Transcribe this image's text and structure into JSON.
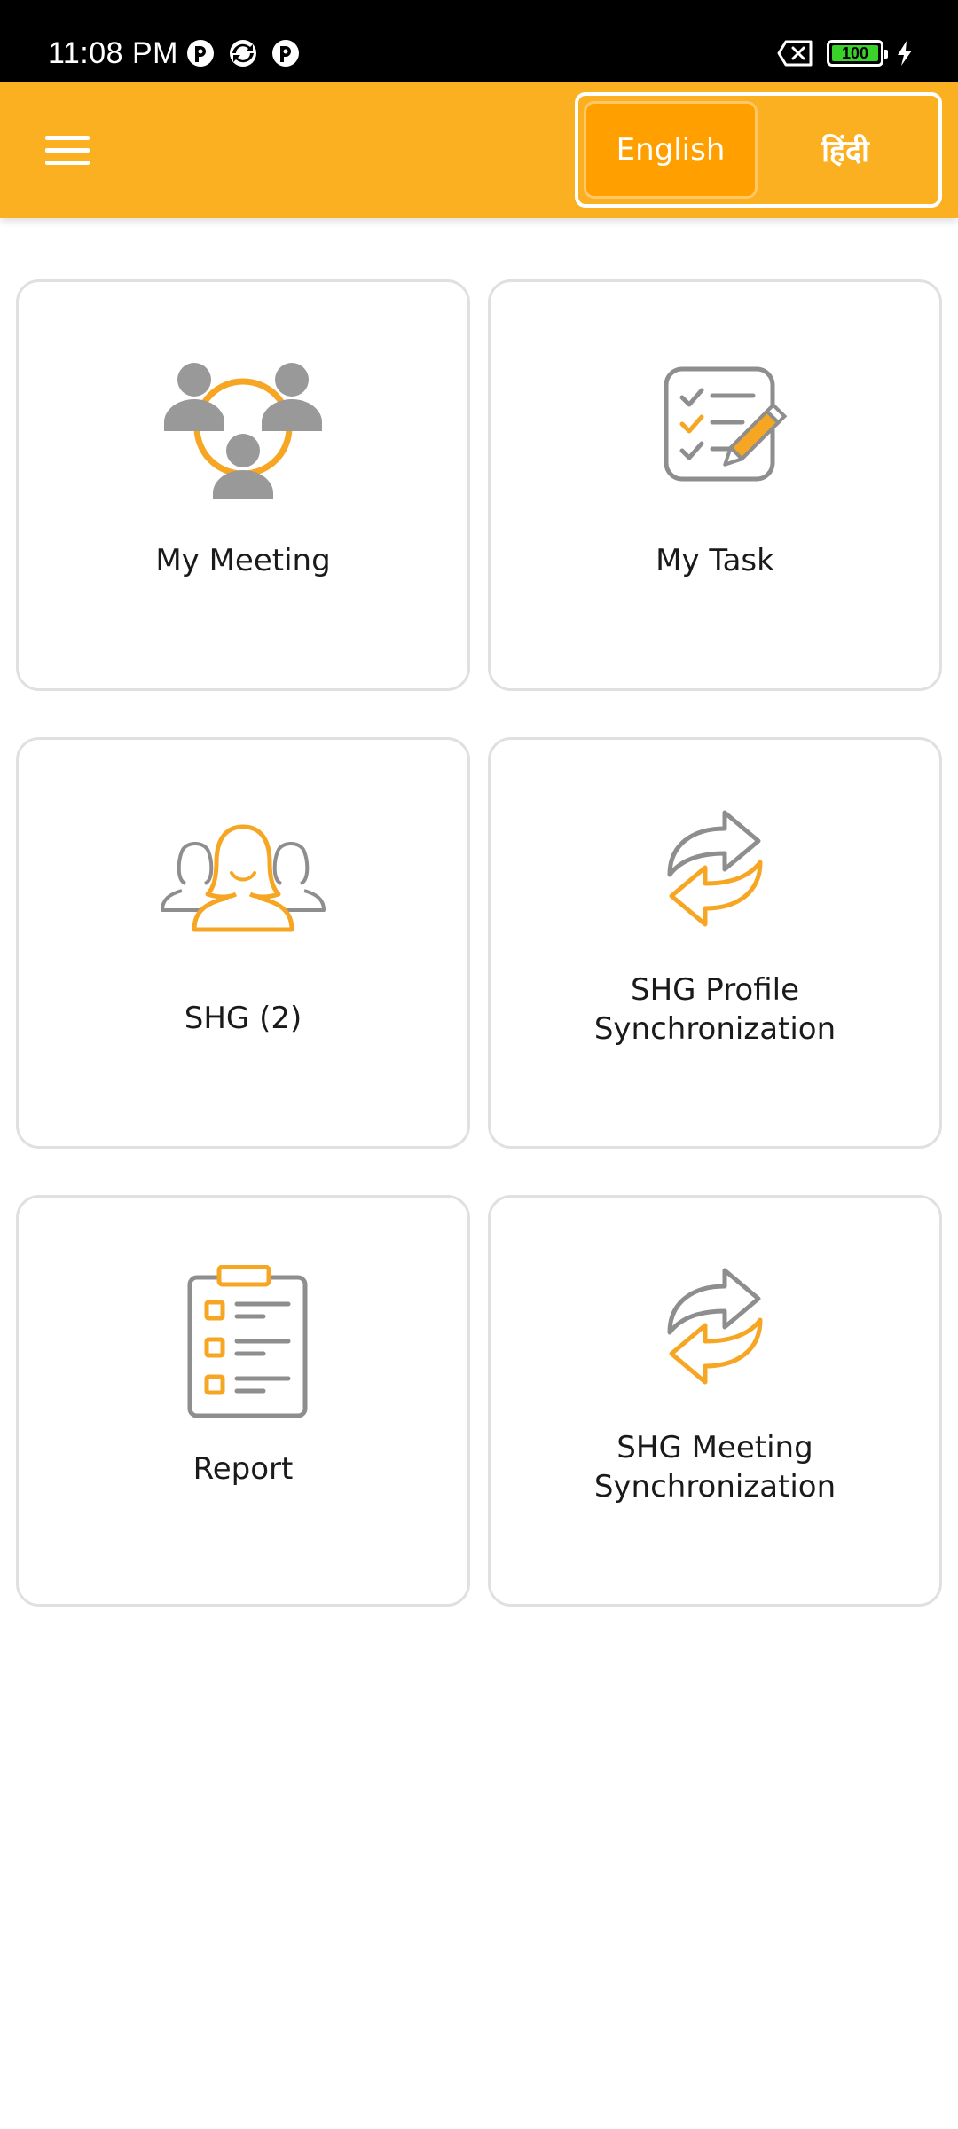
{
  "status_bar": {
    "time": "11:08 PM",
    "battery_level": "100",
    "battery_color": "#39d12a"
  },
  "app_bar": {
    "background": "#fbb021",
    "menu_icon": "hamburger-menu-icon",
    "language": {
      "english": "English",
      "hindi": "हिंदी",
      "selected": "English"
    }
  },
  "tiles": [
    {
      "label": "My Meeting",
      "icon": "meeting-group-icon"
    },
    {
      "label": "My Task",
      "icon": "task-checklist-icon"
    },
    {
      "label": "SHG (2)",
      "icon": "shg-women-group-icon"
    },
    {
      "label": "SHG Profile\nSynchronization",
      "icon": "sync-arrows-icon"
    },
    {
      "label": "Report",
      "icon": "report-clipboard-icon"
    },
    {
      "label": "SHG Meeting\nSynchronization",
      "icon": "sync-arrows-icon"
    }
  ],
  "colors": {
    "accent": "#fbb021",
    "accent_dark": "#ff9f00",
    "icon_gray": "#8e8e8e",
    "icon_orange": "#f6a623"
  }
}
